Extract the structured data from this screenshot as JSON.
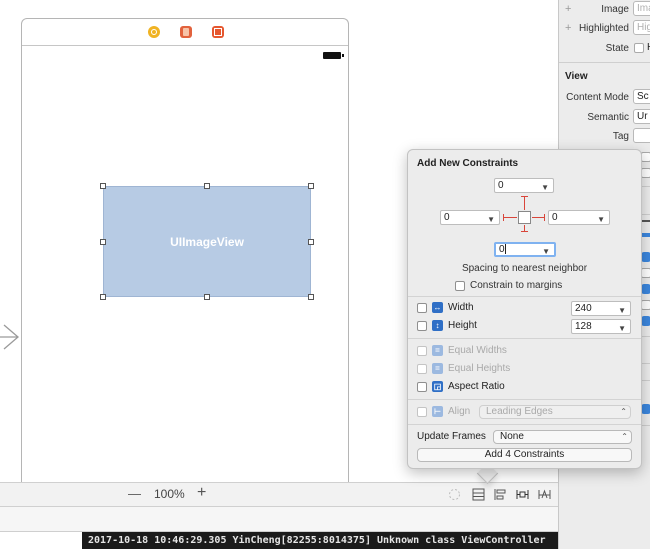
{
  "canvas": {
    "imageview_label": "UIImageView",
    "dock_icons": [
      "view-controller-icon",
      "first-responder-icon",
      "exit-icon"
    ],
    "zoom_out": "—",
    "zoom_level": "100%",
    "zoom_in": "+"
  },
  "console": {
    "line": "2017-10-18 10:46:29.305 YinCheng[82255:8014375] Unknown class ViewController"
  },
  "inspector": {
    "image_label": "Image",
    "image_placeholder": "Image",
    "highlighted_label": "Highlighted",
    "highlighted_placeholder": "Highlighted",
    "state_label": "State",
    "state_value": "H",
    "section_view": "View",
    "content_mode_label": "Content Mode",
    "content_mode_value": "Sc",
    "semantic_label": "Semantic",
    "semantic_value": "Ur",
    "tag_label": "Tag",
    "tag_value": "",
    "add_symbol": "+"
  },
  "popover": {
    "title": "Add New Constraints",
    "top_value": "0",
    "left_value": "0",
    "right_value": "0",
    "bottom_value": "0",
    "spacing_label": "Spacing to nearest neighbor",
    "constrain_margins_label": "Constrain to margins",
    "width_label": "Width",
    "width_value": "240",
    "height_label": "Height",
    "height_value": "128",
    "equal_widths_label": "Equal Widths",
    "equal_heights_label": "Equal Heights",
    "aspect_ratio_label": "Aspect Ratio",
    "align_label": "Align",
    "align_value": "Leading Edges",
    "update_frames_label": "Update Frames",
    "update_frames_value": "None",
    "add_button_label": "Add 4 Constraints"
  }
}
